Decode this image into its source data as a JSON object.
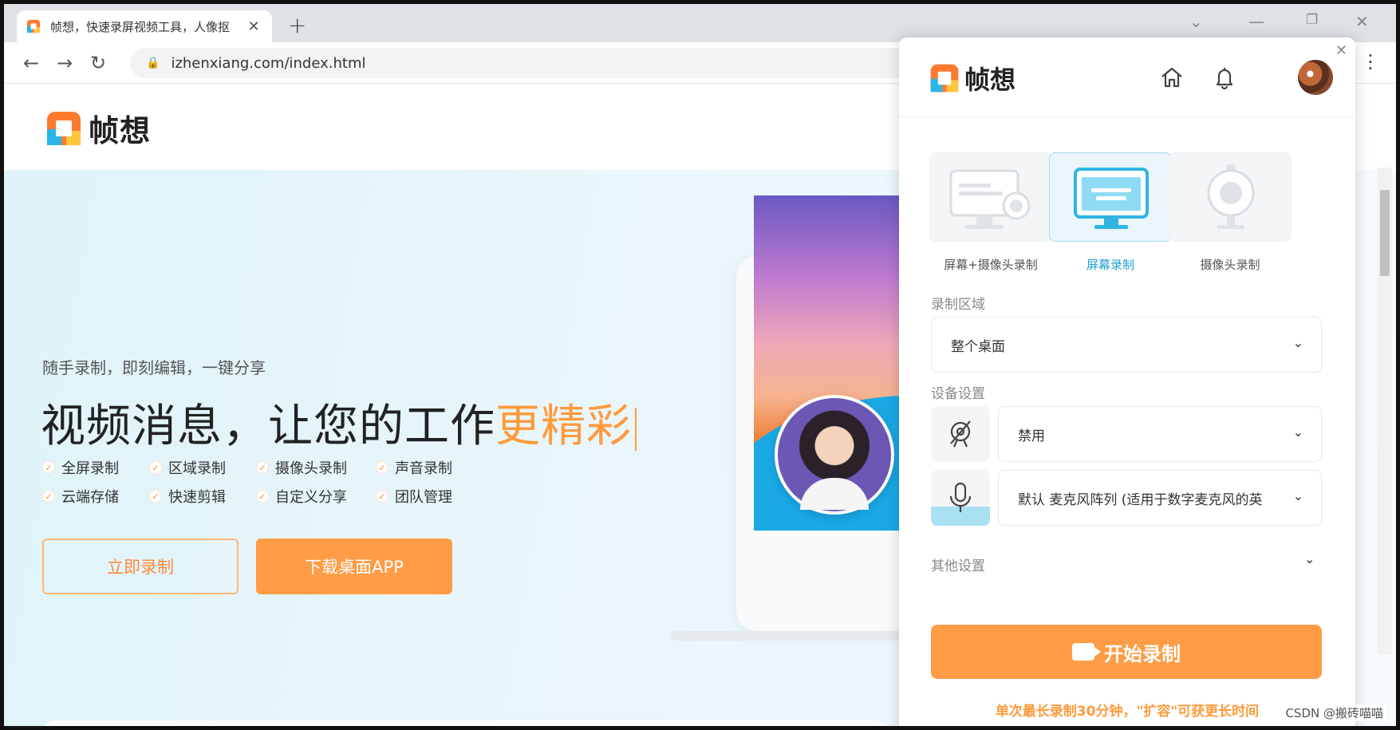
{
  "browser": {
    "tab_title": "帧想，快速录屏视频工具，人像抠",
    "new_tab_symbol": "+",
    "url": "izhenxiang.com/index.html"
  },
  "site": {
    "logo_text": "帧想",
    "hero_subtitle": "随手录制，即刻编辑，一键分享",
    "hero_title_main": "视频消息，让您的工作",
    "hero_title_accent": "更精彩",
    "features": [
      "全屏录制",
      "区域录制",
      "摄像头录制",
      "声音录制",
      "云端存储",
      "快速剪辑",
      "自定义分享",
      "团队管理"
    ],
    "btn_record_now": "立即录制",
    "btn_download": "下载桌面APP"
  },
  "popup": {
    "logo_text": "帧想",
    "modes": [
      {
        "label": "屏幕+摄像头录制",
        "active": false
      },
      {
        "label": "屏幕录制",
        "active": true
      },
      {
        "label": "摄像头录制",
        "active": false
      }
    ],
    "record_area_label": "录制区域",
    "record_area_value": "整个桌面",
    "device_settings_label": "设备设置",
    "camera_value": "禁用",
    "mic_value": "默认 麦克风阵列 (适用于数字麦克风的英",
    "other_settings_label": "其他设置",
    "start_button": "开始录制",
    "tip": "单次最长录制30分钟，\"扩容\"可获更长时间"
  },
  "watermark": "CSDN @搬砖喵喵",
  "colors": {
    "accent_orange": "#ff9c45",
    "accent_blue": "#1ea0d2"
  }
}
